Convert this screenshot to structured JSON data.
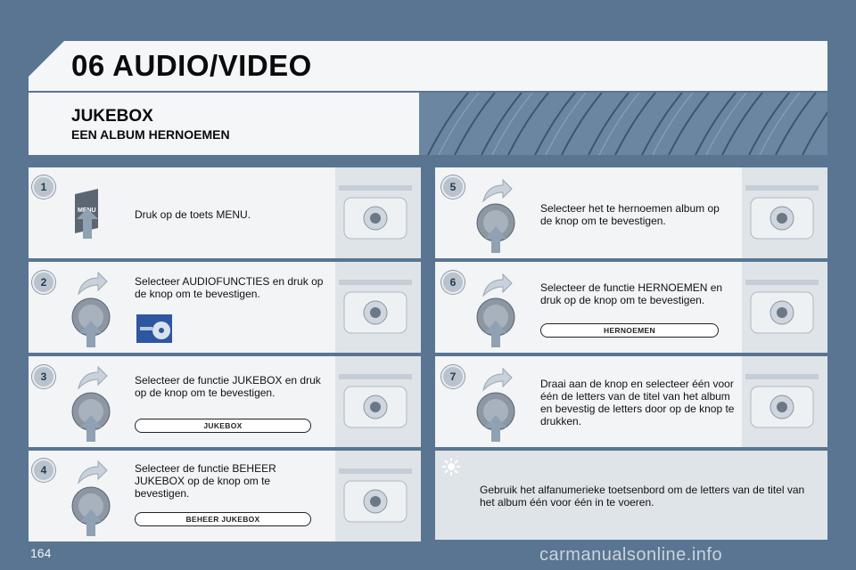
{
  "page": {
    "chapter": "06 AUDIO/VIDEO",
    "section_title": "JUKEBOX",
    "section_subtitle": "EEN ALBUM HERNOEMEN",
    "page_number": "164",
    "watermark": "carmanualsonline.info"
  },
  "steps": [
    {
      "number": "1",
      "text": "Druk op de toets MENU.",
      "key_label": "MENU"
    },
    {
      "number": "2",
      "text": "Selecteer AUDIOFUNCTIES en druk op de knop om te bevestigen."
    },
    {
      "number": "3",
      "text": "Selecteer de functie JUKEBOX en druk op de knop om te bevestigen.",
      "option": "JUKEBOX"
    },
    {
      "number": "4",
      "text": "Selecteer de functie BEHEER JUKEBOX op de knop om te bevestigen.",
      "option": "BEHEER JUKEBOX"
    },
    {
      "number": "5",
      "text": "Selecteer het te hernoemen album op de knop om te bevestigen."
    },
    {
      "number": "6",
      "text": "Selecteer de functie HERNOEMEN en druk op de knop om te bevestigen.",
      "option": "HERNOEMEN"
    },
    {
      "number": "7",
      "text": "Draai aan de knop en selecteer één voor één de letters van de titel van het album en bevestig de letters door op de knop te drukken."
    }
  ],
  "tip": {
    "icon": "sun-icon",
    "text": "Gebruik het alfanumerieke toetsenbord om de letters van de titel van het album één voor één in te voeren."
  },
  "colors": {
    "page_background": "#597592",
    "panel": "#f2f4f6",
    "thumbnail": "#dfe4e9"
  }
}
